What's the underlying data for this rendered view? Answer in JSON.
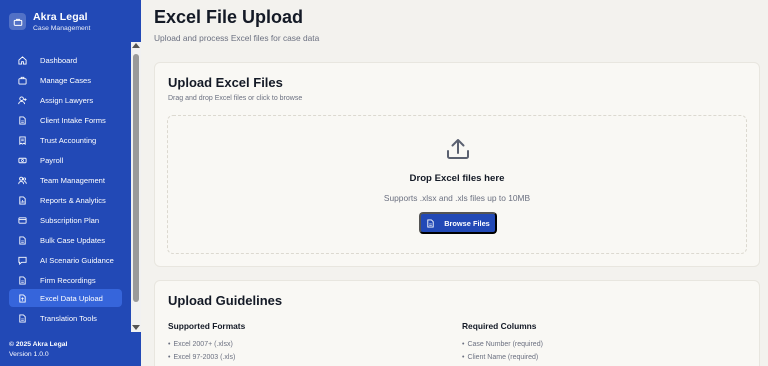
{
  "brand": {
    "name": "Akra Legal",
    "subtitle": "Case Management"
  },
  "sidebar": {
    "items": [
      {
        "label": "Dashboard",
        "icon": "home-icon"
      },
      {
        "label": "Manage Cases",
        "icon": "briefcase-icon"
      },
      {
        "label": "Assign Lawyers",
        "icon": "user-plus-icon"
      },
      {
        "label": "Client Intake Forms",
        "icon": "file-icon"
      },
      {
        "label": "Trust Accounting",
        "icon": "receipt-icon"
      },
      {
        "label": "Payroll",
        "icon": "payroll-icon"
      },
      {
        "label": "Team Management",
        "icon": "users-icon"
      },
      {
        "label": "Reports & Analytics",
        "icon": "chart-icon"
      },
      {
        "label": "Subscription Plan",
        "icon": "card-icon"
      },
      {
        "label": "Bulk Case Updates",
        "icon": "file-icon"
      },
      {
        "label": "AI Scenario Guidance",
        "icon": "chat-icon"
      },
      {
        "label": "Firm Recordings",
        "icon": "file-icon"
      },
      {
        "label": "Excel Data Upload",
        "icon": "file-upload-icon",
        "active": true
      },
      {
        "label": "Translation Tools",
        "icon": "file-icon"
      }
    ]
  },
  "footer": {
    "copyright": "© 2025 Akra Legal",
    "version": "Version 1.0.0"
  },
  "page": {
    "title": "Excel File Upload",
    "subtitle": "Upload and process Excel files for case data"
  },
  "upload_card": {
    "title": "Upload Excel Files",
    "description": "Drag and drop Excel files or click to browse",
    "drop_title": "Drop Excel files here",
    "drop_subtitle": "Supports .xlsx and .xls files up to 10MB",
    "browse_label": "Browse Files"
  },
  "guidelines": {
    "title": "Upload Guidelines",
    "supported_title": "Supported Formats",
    "supported": [
      "Excel 2007+ (.xlsx)",
      "Excel 97-2003 (.xls)"
    ],
    "required_title": "Required Columns",
    "required": [
      "Case Number (required)",
      "Client Name (required)"
    ]
  },
  "colors": {
    "sidebar": "#2249b6",
    "active_item": "#3665db",
    "accent": "#2249b6",
    "background": "#f3f2ee"
  }
}
